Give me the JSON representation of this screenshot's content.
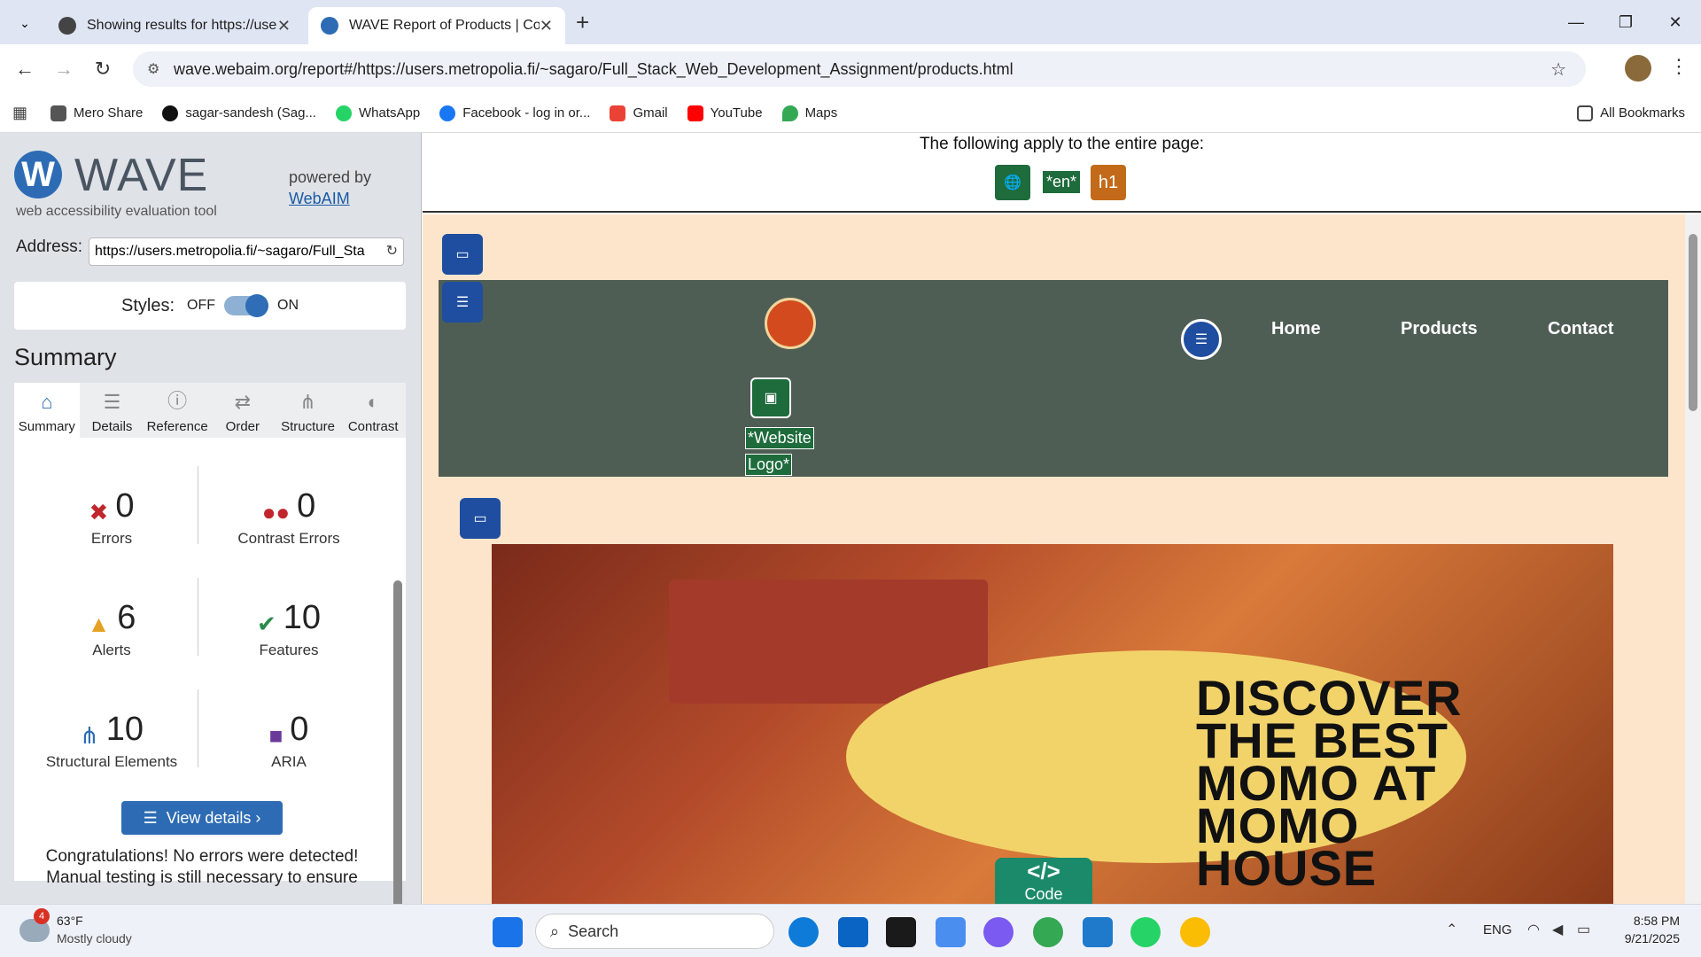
{
  "browser": {
    "tabs": [
      {
        "title": "Showing results for https://user"
      },
      {
        "title": "WAVE Report of Products | Com"
      }
    ],
    "url": "wave.webaim.org/report#/https://users.metropolia.fi/~sagaro/Full_Stack_Web_Development_Assignment/products.html",
    "bookmarks": [
      "Mero Share",
      "sagar-sandesh (Sag...",
      "WhatsApp",
      "Facebook - log in or...",
      "Gmail",
      "YouTube",
      "Maps"
    ],
    "all_bookmarks": "All Bookmarks"
  },
  "wave": {
    "title": "WAVE",
    "subtitle": "web accessibility evaluation tool",
    "powered_by": "powered by",
    "webaim": "WebAIM",
    "address_label": "Address:",
    "address_value": "https://users.metropolia.fi/~sagaro/Full_Sta",
    "styles_label": "Styles:",
    "styles_off": "OFF",
    "styles_on": "ON",
    "summary_title": "Summary",
    "tabs": [
      "Summary",
      "Details",
      "Reference",
      "Order",
      "Structure",
      "Contrast"
    ],
    "stats": {
      "errors": {
        "value": "0",
        "label": "Errors"
      },
      "contrast": {
        "value": "0",
        "label": "Contrast Errors"
      },
      "alerts": {
        "value": "6",
        "label": "Alerts"
      },
      "features": {
        "value": "10",
        "label": "Features"
      },
      "structural": {
        "value": "10",
        "label": "Structural Elements"
      },
      "aria": {
        "value": "0",
        "label": "ARIA"
      }
    },
    "view_details": "View details ›",
    "congrats": "Congratulations! No errors were detected! Manual testing is still necessary to ensure"
  },
  "page": {
    "apply_text": "The following apply to the entire page:",
    "lang_badge": "*en*",
    "h1_badge": "h1",
    "nav": [
      "Home",
      "Products",
      "Contact"
    ],
    "logo_alt_1": "*Website",
    "logo_alt_2": "Logo*",
    "hero_title": "DISCOVER THE BEST MOMO AT MOMO HOUSE",
    "code_label": "Code",
    "code_icon": "</>"
  },
  "taskbar": {
    "weather_temp": "63°F",
    "weather_desc": "Mostly cloudy",
    "weather_badge": "4",
    "search": "Search",
    "lang": "ENG",
    "time": "8:58 PM",
    "date": "9/21/2025"
  }
}
